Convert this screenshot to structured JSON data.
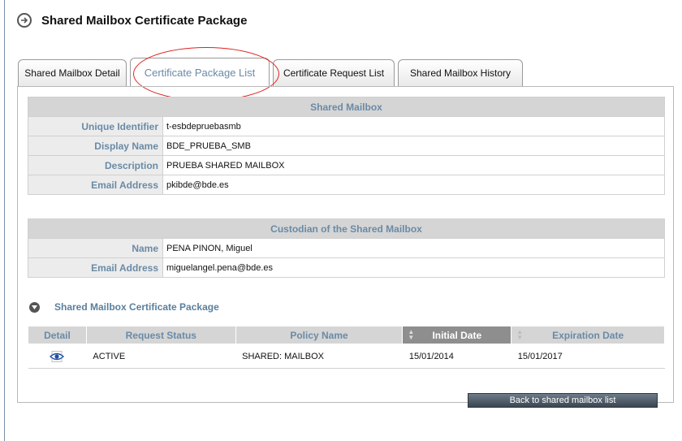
{
  "header": {
    "title": "Shared Mailbox Certificate Package",
    "icon": "arrow-right-circle-icon"
  },
  "tabs": [
    {
      "label": "Shared Mailbox Detail",
      "active": false
    },
    {
      "label": "Certificate Package List",
      "active": true
    },
    {
      "label": "Certificate Request List",
      "active": false
    },
    {
      "label": "Shared Mailbox History",
      "active": false
    }
  ],
  "mailbox": {
    "heading": "Shared Mailbox",
    "rows": [
      {
        "label": "Unique Identifier",
        "value": "t-esbdepruebasmb"
      },
      {
        "label": "Display Name",
        "value": "BDE_PRUEBA_SMB"
      },
      {
        "label": "Description",
        "value": "PRUEBA SHARED MAILBOX"
      },
      {
        "label": "Email Address",
        "value": "pkibde@bde.es"
      }
    ]
  },
  "custodian": {
    "heading": "Custodian of the Shared Mailbox",
    "rows": [
      {
        "label": "Name",
        "value": "PENA PINON, Miguel"
      },
      {
        "label": "Email Address",
        "value": "miguelangel.pena@bde.es"
      }
    ]
  },
  "package": {
    "title": "Shared Mailbox Certificate Package",
    "columns": [
      "Detail",
      "Request Status",
      "Policy Name",
      "Initial Date",
      "Expiration Date"
    ],
    "rows": [
      {
        "status": "ACTIVE",
        "policy": "SHARED: MAILBOX",
        "initial": "15/01/2014",
        "expiration": "15/01/2017"
      }
    ]
  },
  "back_button": "Back to shared mailbox list",
  "colors": {
    "label_blue": "#6a8aa6",
    "annotation_red": "#d22222",
    "header_gray": "#d5d5d5",
    "sorted_gray": "#8e8e8e"
  }
}
